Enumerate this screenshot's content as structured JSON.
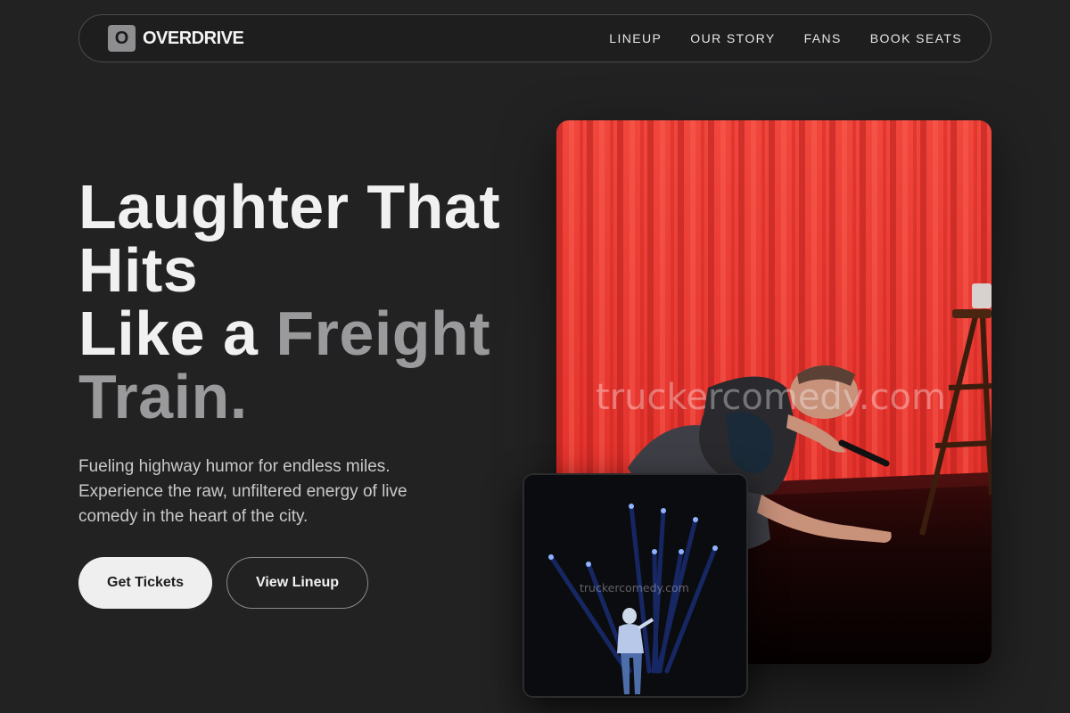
{
  "brand": {
    "mark": "O",
    "name": "OVERDRIVE"
  },
  "nav": {
    "links": [
      {
        "label": "LINEUP"
      },
      {
        "label": "OUR STORY"
      },
      {
        "label": "FANS"
      },
      {
        "label": "BOOK SEATS"
      }
    ]
  },
  "hero": {
    "title_line1": "Laughter That",
    "title_line2": "Hits",
    "title_line3_plain": "Like a ",
    "title_line3_accent": "Freight",
    "title_line4_accent": "Train.",
    "subtitle": "Fueling highway humor for endless miles. Experience the raw, unfiltered energy of live comedy in the heart of the city.",
    "primary_button": "Get Tickets",
    "secondary_button": "View Lineup"
  },
  "photos": {
    "main_watermark": "truckercomedy.com",
    "inset_watermark": "truckercomedy.com"
  },
  "colors": {
    "background": "#222223",
    "accent_text": "#9a9a9c",
    "curtain_red": "#e2322c",
    "spotlight_blue": "#2d5bff"
  }
}
